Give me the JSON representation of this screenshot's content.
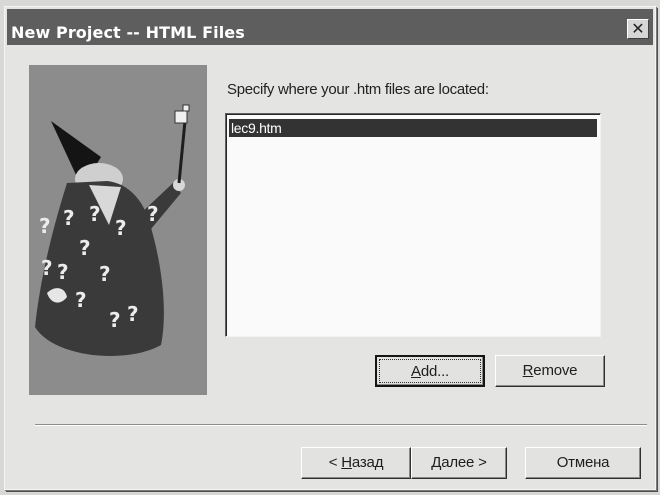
{
  "window": {
    "title": "New Project -- HTML Files",
    "close_glyph": "✕"
  },
  "wizard_image": {
    "icon": "wizard-icon",
    "glyph": "?"
  },
  "files": {
    "prompt": "Specify where your .htm files are located:",
    "items": [
      "lec9.htm"
    ],
    "selected_index": 0
  },
  "buttons": {
    "add": {
      "before": "",
      "mnemonic": "A",
      "after": "dd..."
    },
    "remove": {
      "before": "",
      "mnemonic": "R",
      "after": "emove"
    },
    "back": {
      "before": "< ",
      "mnemonic": "Н",
      "after": "азад"
    },
    "next": {
      "label": "Далее >"
    },
    "cancel": {
      "label": "Отмена"
    }
  },
  "colors": {
    "title_bar": "#5e5e5e",
    "selection": "#333333",
    "dialog_face": "#e4e4e2",
    "list_background": "#fafafa"
  }
}
